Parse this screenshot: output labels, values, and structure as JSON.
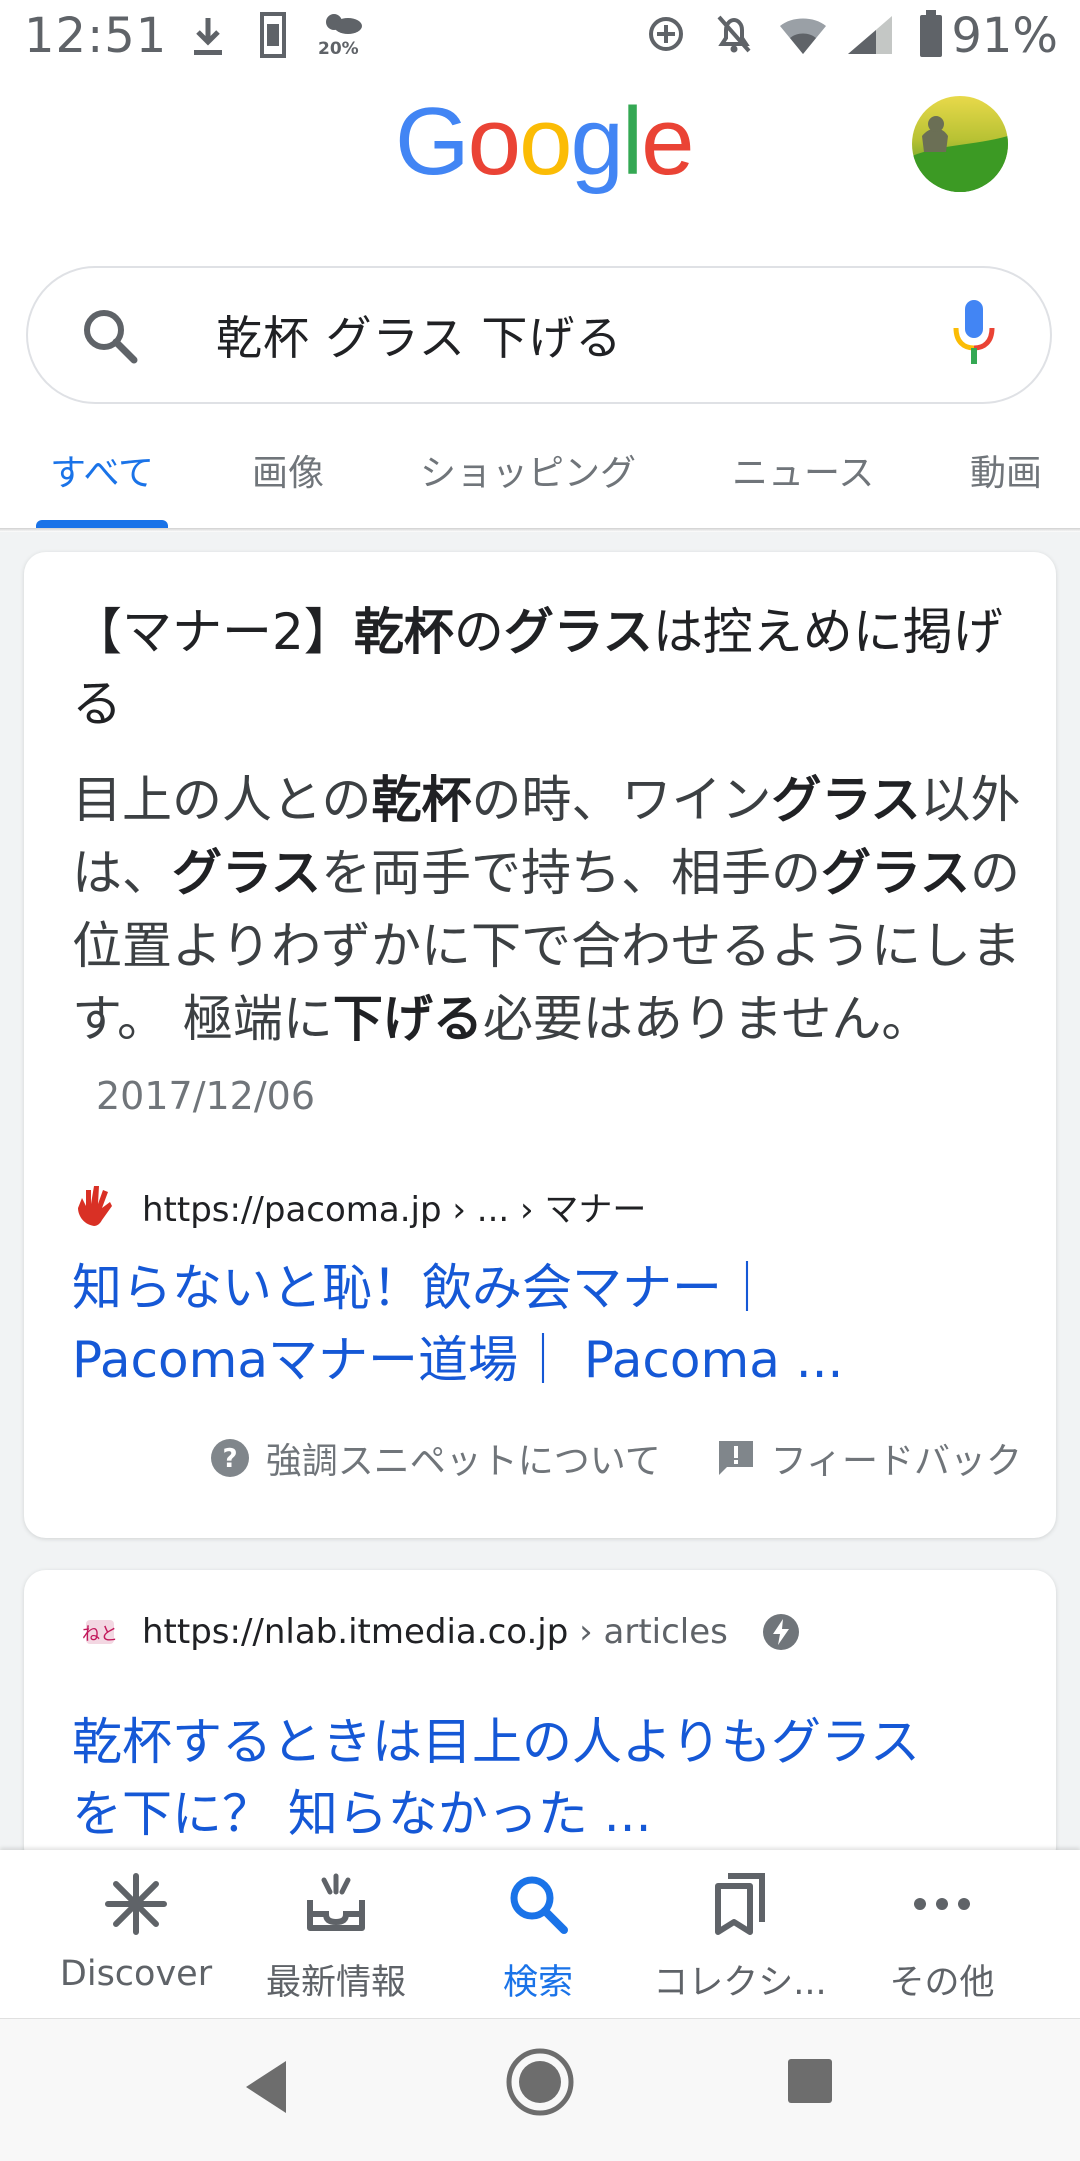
{
  "status_bar": {
    "time": "12:51",
    "weather_label": "20%",
    "battery": "91%",
    "icons": [
      "download-icon",
      "sim-card-icon",
      "weather-icon",
      "data-saver-icon",
      "notifications-off-icon",
      "wifi-icon",
      "signal-icon",
      "battery-icon"
    ]
  },
  "header": {
    "logo_text": "Google",
    "logo_colors": [
      "#4285F4",
      "#EA4335",
      "#FBBC05",
      "#4285F4",
      "#34A853",
      "#EA4335"
    ]
  },
  "search": {
    "query": "乾杯 グラス 下げる"
  },
  "tabs": [
    {
      "label": "すべて",
      "active": true
    },
    {
      "label": "画像",
      "active": false
    },
    {
      "label": "ショッピング",
      "active": false
    },
    {
      "label": "ニュース",
      "active": false
    },
    {
      "label": "動画",
      "active": false
    }
  ],
  "featured_snippet": {
    "title_parts": [
      "【マナー2】",
      "乾杯",
      "の",
      "グラス",
      "は控えめに掲げる"
    ],
    "body_parts": [
      "目上の人との",
      "乾杯",
      "の時、ワイン",
      "グラス",
      "以外は、",
      "グラス",
      "を両手で持ち、相手の",
      "グラス",
      "の位置よりわずかに下で合わせるようにします。 極端に",
      "下げる",
      "必要はありません。"
    ],
    "date": "2017/12/06",
    "source_url": "https://pacoma.jp",
    "source_path": " › ... › マナー",
    "link_line1": "知らないと恥！飲み会マナー｜",
    "link_line2": "Pacomaマナー道場｜ Pacoma ...",
    "footer_about": "強調スニペットについて",
    "footer_feedback": "フィードバック"
  },
  "result2": {
    "source_url": "https://nlab.itmedia.co.jp",
    "source_path": " › articles",
    "link_line1": "乾杯するときは目上の人よりもグラス",
    "link_line2": "を下に？ 知らなかった ..."
  },
  "bottom_nav": [
    {
      "label": "Discover",
      "icon": "asterisk-icon",
      "active": false
    },
    {
      "label": "最新情報",
      "icon": "updates-tray-icon",
      "active": false
    },
    {
      "label": "検索",
      "icon": "search-icon",
      "active": true
    },
    {
      "label": "コレクシ...",
      "icon": "collections-icon",
      "active": false
    },
    {
      "label": "その他",
      "icon": "more-icon",
      "active": false
    }
  ],
  "colors": {
    "accent": "#1a73e8",
    "link": "#1558d6",
    "text": "#202124",
    "secondary": "#70757a"
  }
}
